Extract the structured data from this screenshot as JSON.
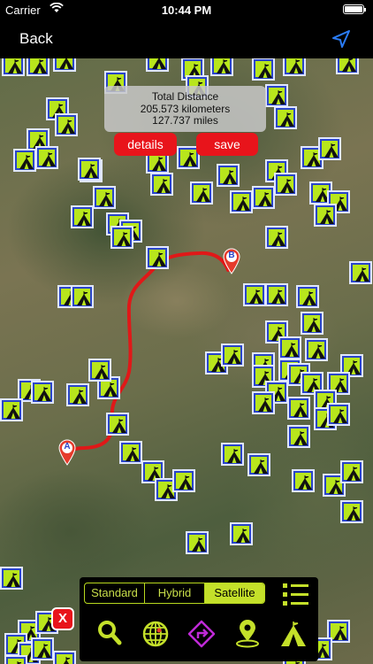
{
  "status_bar": {
    "carrier": "Carrier",
    "time": "10:44 PM"
  },
  "nav": {
    "back_label": "Back"
  },
  "distance": {
    "title": "Total Distance",
    "kilometers": "205.573 kilometers",
    "miles": "127.737 miles"
  },
  "buttons": {
    "details": "details",
    "save": "save",
    "close": "X"
  },
  "markers": {
    "start": "A",
    "end": "B"
  },
  "map_types": [
    "Standard",
    "Hybrid",
    "Satellite"
  ],
  "map_type_selected": "Satellite",
  "toolbar_icons": [
    "search-icon",
    "globe-grid-icon",
    "directions-icon",
    "location-pin-icon",
    "campsite-icon"
  ],
  "colors": {
    "route": "#e01818",
    "accent_green": "#c4e02a",
    "camp_blue": "#2a45c9",
    "camp_green": "#b8e61c",
    "directions_purple": "#c02ad8"
  }
}
